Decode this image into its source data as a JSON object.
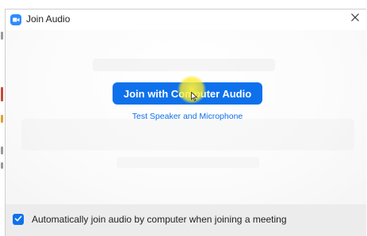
{
  "window": {
    "title": "Join Audio",
    "close_label": "×"
  },
  "main": {
    "join_button_label": "Join with Computer Audio",
    "test_link_label": "Test Speaker and Microphone"
  },
  "footer": {
    "auto_join_checked": true,
    "auto_join_label": "Automatically join audio by computer when joining a meeting"
  },
  "colors": {
    "accent": "#0e71eb",
    "icon_blue": "#2d8cff",
    "footer_bg": "#ececec"
  },
  "icons": [
    "zoom-app-icon",
    "close-icon",
    "checkmark-icon",
    "mouse-cursor-icon"
  ]
}
